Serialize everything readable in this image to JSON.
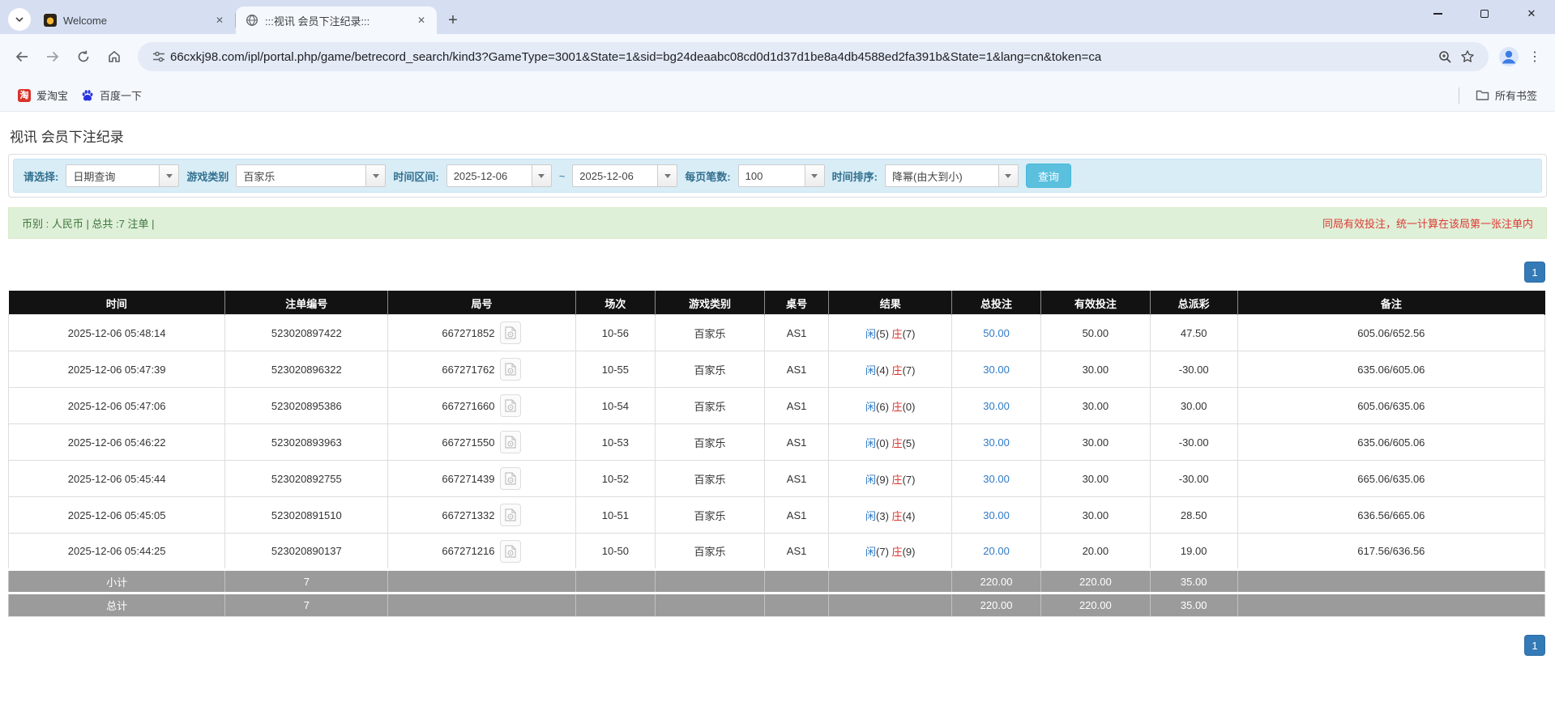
{
  "browser": {
    "tabs": [
      {
        "title": "Welcome"
      },
      {
        "title": ":::视讯 会员下注纪录:::"
      }
    ],
    "url": "66cxkj98.com/ipl/portal.php/game/betrecord_search/kind3?GameType=3001&State=1&sid=bg24deaabc08cd0d1d37d1be8a4db4588ed2fa391b&State=1&lang=cn&token=ca",
    "bookmarks": [
      {
        "label": "爱淘宝",
        "favicon_text": "淘"
      },
      {
        "label": "百度一下"
      }
    ],
    "all_bookmarks_label": "所有书签"
  },
  "page": {
    "title": "视讯 会员下注纪录",
    "filters": {
      "select_label": "请选择:",
      "select_value": "日期查询",
      "game_type_label": "游戏类别",
      "game_type_value": "百家乐",
      "date_range_label": "时间区间:",
      "date_from": "2025-12-06",
      "tilde": "~",
      "date_to": "2025-12-06",
      "page_size_label": "每页笔数:",
      "page_size_value": "100",
      "sort_label": "时间排序:",
      "sort_value": "降幂(由大到小)",
      "search_button": "查询"
    },
    "info_bar": {
      "left": "币别 : 人民币 | 总共 :7 注单 |",
      "right": "同局有效投注，统一计算在该局第一张注单内"
    },
    "pagination": {
      "page": "1"
    },
    "table": {
      "headers": [
        "时间",
        "注单编号",
        "局号",
        "场次",
        "游戏类别",
        "桌号",
        "结果",
        "总投注",
        "有效投注",
        "总派彩",
        "备注"
      ],
      "rows": [
        {
          "time": "2025-12-06 05:48:14",
          "bet_id": "523020897422",
          "round_id": "667271852",
          "session": "10-56",
          "game": "百家乐",
          "table_no": "AS1",
          "result_player": "闲",
          "result_player_score": "(5)",
          "result_banker": "庄",
          "result_banker_score": "(7)",
          "total_bet": "50.00",
          "valid_bet": "50.00",
          "payout": "47.50",
          "payout_negative": false,
          "note": "605.06/652.56"
        },
        {
          "time": "2025-12-06 05:47:39",
          "bet_id": "523020896322",
          "round_id": "667271762",
          "session": "10-55",
          "game": "百家乐",
          "table_no": "AS1",
          "result_player": "闲",
          "result_player_score": "(4)",
          "result_banker": "庄",
          "result_banker_score": "(7)",
          "total_bet": "30.00",
          "valid_bet": "30.00",
          "payout": "-30.00",
          "payout_negative": true,
          "note": "635.06/605.06"
        },
        {
          "time": "2025-12-06 05:47:06",
          "bet_id": "523020895386",
          "round_id": "667271660",
          "session": "10-54",
          "game": "百家乐",
          "table_no": "AS1",
          "result_player": "闲",
          "result_player_score": "(6)",
          "result_banker": "庄",
          "result_banker_score": "(0)",
          "total_bet": "30.00",
          "valid_bet": "30.00",
          "payout": "30.00",
          "payout_negative": false,
          "note": "605.06/635.06"
        },
        {
          "time": "2025-12-06 05:46:22",
          "bet_id": "523020893963",
          "round_id": "667271550",
          "session": "10-53",
          "game": "百家乐",
          "table_no": "AS1",
          "result_player": "闲",
          "result_player_score": "(0)",
          "result_banker": "庄",
          "result_banker_score": "(5)",
          "total_bet": "30.00",
          "valid_bet": "30.00",
          "payout": "-30.00",
          "payout_negative": true,
          "note": "635.06/605.06"
        },
        {
          "time": "2025-12-06 05:45:44",
          "bet_id": "523020892755",
          "round_id": "667271439",
          "session": "10-52",
          "game": "百家乐",
          "table_no": "AS1",
          "result_player": "闲",
          "result_player_score": "(9)",
          "result_banker": "庄",
          "result_banker_score": "(7)",
          "total_bet": "30.00",
          "valid_bet": "30.00",
          "payout": "-30.00",
          "payout_negative": true,
          "note": "665.06/635.06"
        },
        {
          "time": "2025-12-06 05:45:05",
          "bet_id": "523020891510",
          "round_id": "667271332",
          "session": "10-51",
          "game": "百家乐",
          "table_no": "AS1",
          "result_player": "闲",
          "result_player_score": "(3)",
          "result_banker": "庄",
          "result_banker_score": "(4)",
          "total_bet": "30.00",
          "valid_bet": "30.00",
          "payout": "28.50",
          "payout_negative": false,
          "note": "636.56/665.06"
        },
        {
          "time": "2025-12-06 05:44:25",
          "bet_id": "523020890137",
          "round_id": "667271216",
          "session": "10-50",
          "game": "百家乐",
          "table_no": "AS1",
          "result_player": "闲",
          "result_player_score": "(7)",
          "result_banker": "庄",
          "result_banker_score": "(9)",
          "total_bet": "20.00",
          "valid_bet": "20.00",
          "payout": "19.00",
          "payout_negative": false,
          "note": "617.56/636.56"
        }
      ],
      "subtotal": {
        "label": "小计",
        "count": "7",
        "total_bet": "220.00",
        "valid_bet": "220.00",
        "payout": "35.00"
      },
      "total": {
        "label": "总计",
        "count": "7",
        "total_bet": "220.00",
        "valid_bet": "220.00",
        "payout": "35.00"
      }
    },
    "colors": {
      "accent_blue": "#337ab7",
      "filter_bg": "#d9edf7",
      "info_bg": "#dff0d8",
      "negative_red": "#dd3333",
      "summary_gray": "#9b9b9b"
    }
  }
}
